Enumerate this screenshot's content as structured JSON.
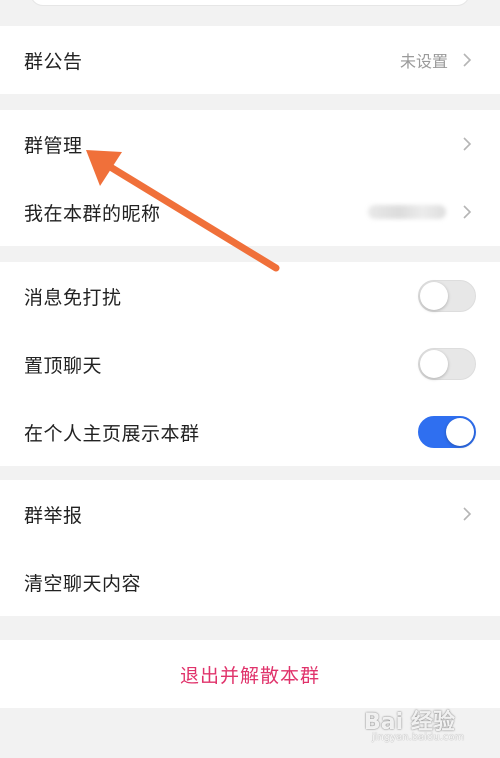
{
  "group_info": {
    "announcement_label": "群公告",
    "announcement_value": "未设置",
    "management_label": "群管理",
    "nickname_label": "我在本群的昵称"
  },
  "settings": {
    "mute_label": "消息免打扰",
    "mute_on": false,
    "pin_label": "置顶聊天",
    "pin_on": false,
    "show_profile_label": "在个人主页展示本群",
    "show_profile_on": true
  },
  "other": {
    "report_label": "群举报",
    "clear_label": "清空聊天内容"
  },
  "danger": {
    "leave_label": "退出并解散本群"
  },
  "watermark": {
    "text": "Bai 经验",
    "sub": "jingyan.baidu.com"
  },
  "colors": {
    "accent": "#2f6ff0",
    "danger": "#e0336b",
    "annotation": "#f0703a"
  }
}
